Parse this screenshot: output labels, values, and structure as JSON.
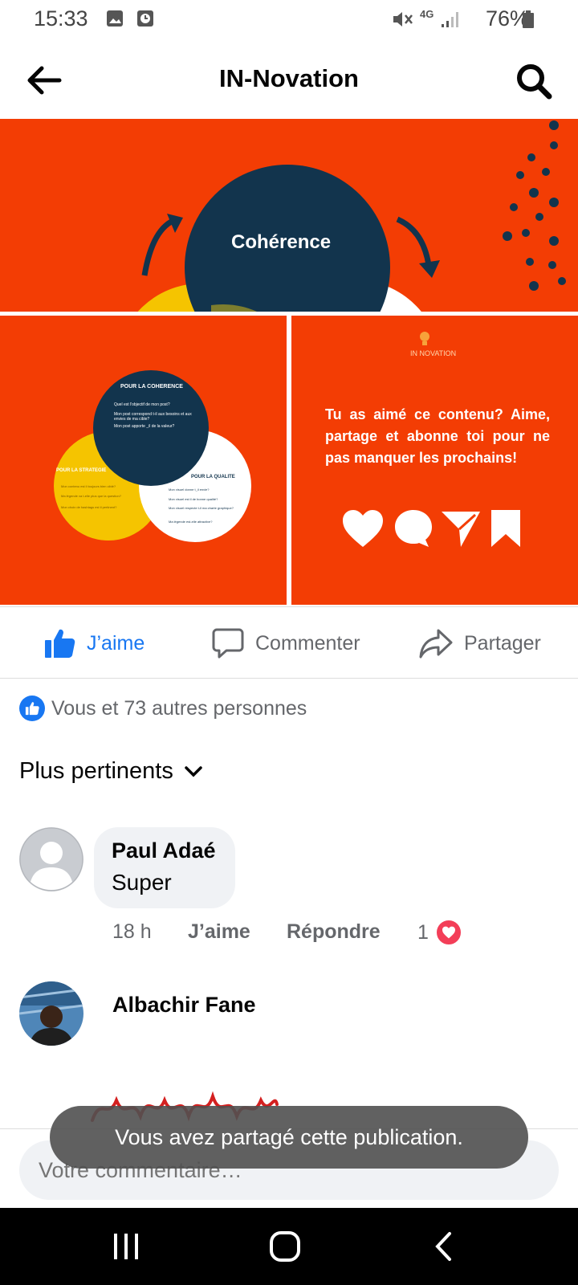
{
  "status_bar": {
    "time": "15:33",
    "network": "4G",
    "battery": "76%"
  },
  "header": {
    "title": "IN-Novation"
  },
  "post": {
    "image_top_label": "Cohérence",
    "image_bl": {
      "heading_coherence": "POUR LA COHERENCE",
      "q1": "Quel est l'objectif de mon post?",
      "q2": "Mon post correspond t-il aux besoins et aux envies de ma cible?",
      "q3": "Mon post apporte _il de la valeur?",
      "heading_strategie": "POUR LA STRATEGIE",
      "s1": "Mon contenu est il toujours bien ciblé?",
      "s2": "Ma légende va t-elle plus que la question?",
      "s3": "Mon choix de hashtags est il pertinent?",
      "heading_qualite": "POUR LA QUALITE",
      "ql1": "Mon visuel donne t_il envie?",
      "ql2": "Mon visuel est il de bonne qualité?",
      "ql3": "Mon visuel respecte t-il ma charte graphique?",
      "ql4": "Ma légende est-elle attractive?"
    },
    "image_br": {
      "brand": "IN NOVATION",
      "cta": "Tu as aimé ce contenu? Aime, partage et abonne toi pour ne pas manquer les prochains!"
    }
  },
  "actions": {
    "like": "J’aime",
    "comment": "Commenter",
    "share": "Partager"
  },
  "reactions_summary": "Vous et 73 autres personnes",
  "sort_label": "Plus pertinents",
  "comments": [
    {
      "author": "Paul Adaé",
      "text": "Super",
      "time": "18 h",
      "like": "J’aime",
      "reply": "Répondre",
      "reaction_count": "1"
    },
    {
      "author": "Albachir Fane"
    }
  ],
  "composer": {
    "placeholder": "Votre commentaire…"
  },
  "toast": "Vous avez partagé cette publication.",
  "colors": {
    "accent": "#1877f2",
    "post_orange": "#f33d04",
    "navy": "#12344d",
    "yellow": "#f5c400",
    "heart": "#f33e58"
  }
}
